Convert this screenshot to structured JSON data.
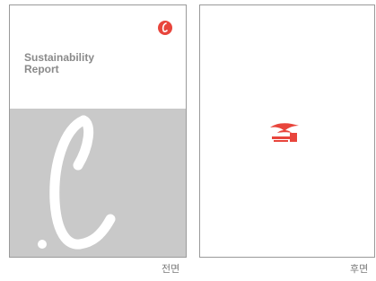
{
  "front_cover": {
    "title_line1": "Sustainability",
    "title_line2": "Report",
    "subtitle": "",
    "brand_text": "",
    "caption": "전면",
    "accent_color": "#e8453c",
    "background_lower": "#c9c9c9",
    "logo_icon": "brand-l-logo-icon"
  },
  "back_cover": {
    "caption": "후면",
    "logo_icon": "brand-ribbon-logo-icon",
    "accent_color": "#e8453c"
  }
}
